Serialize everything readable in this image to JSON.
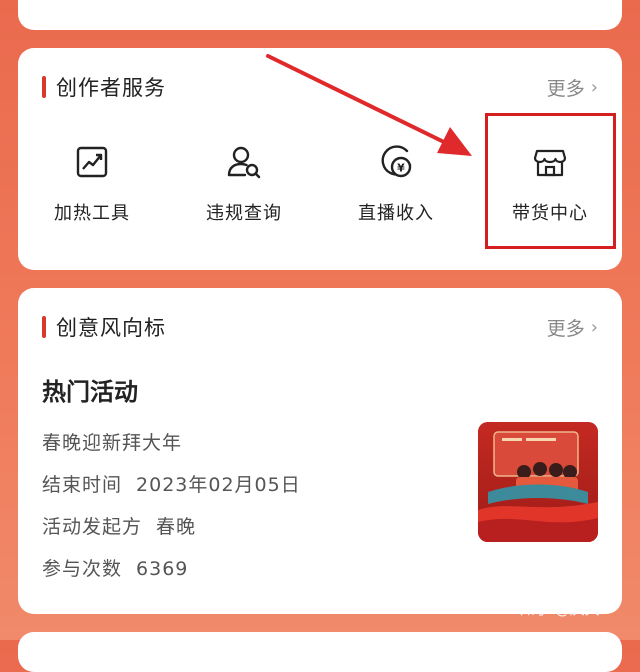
{
  "colors": {
    "accent": "#d73a2a",
    "highlight": "#d51e1e",
    "arrow": "#e0292b",
    "background": "#ea6a4e"
  },
  "creator_services": {
    "title": "创作者服务",
    "more_label": "更多",
    "items": [
      {
        "label": "加热工具",
        "icon": "trending-chart-icon"
      },
      {
        "label": "违规查询",
        "icon": "user-search-icon"
      },
      {
        "label": "直播收入",
        "icon": "coin-yuan-icon"
      },
      {
        "label": "带货中心",
        "icon": "storefront-icon"
      }
    ]
  },
  "creative_trends": {
    "title": "创意风向标",
    "more_label": "更多",
    "activity": {
      "heading": "热门活动",
      "name": "春晚迎新拜大年",
      "end_label": "结束时间",
      "end_value": "2023年02月05日",
      "organizer_label": "活动发起方",
      "organizer_value": "春晚",
      "count_label": "参与次数",
      "count_value": "6369"
    }
  },
  "watermark": "知乎 @庆天"
}
